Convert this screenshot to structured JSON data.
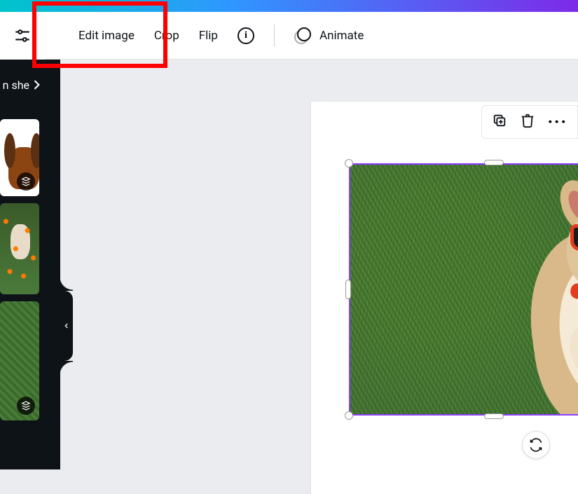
{
  "toolbar": {
    "edit_image": "Edit image",
    "crop": "Crop",
    "flip": "Flip",
    "animate": "Animate"
  },
  "sidebar": {
    "search_fragment": "n she"
  },
  "highlight": {
    "target": "edit-image-button"
  }
}
